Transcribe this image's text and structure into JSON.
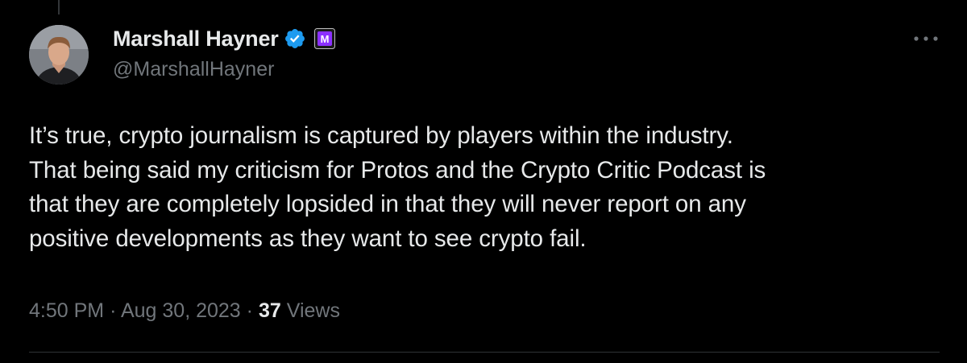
{
  "author": {
    "display_name": "Marshall Hayner",
    "handle": "@MarshallHayner",
    "verified_icon": "verified-badge-icon",
    "affiliate_icon": "affiliate-badge-icon"
  },
  "tweet": {
    "lines": [
      "It’s true, crypto journalism is captured by players within the industry.",
      "That being said my criticism for Protos and the Crypto Critic Podcast is",
      "that they are completely lopsided in that they will never report on any",
      "positive developments as they want to see crypto fail."
    ]
  },
  "meta": {
    "time": "4:50 PM",
    "separator": "·",
    "date": "Aug 30, 2023",
    "views_count": "37",
    "views_label": "Views"
  },
  "colors": {
    "background": "#000000",
    "primary_text": "#e7e9ea",
    "secondary_text": "#71767b",
    "verified_blue": "#1d9bf0",
    "affiliate_purple": "#8b30ff"
  }
}
